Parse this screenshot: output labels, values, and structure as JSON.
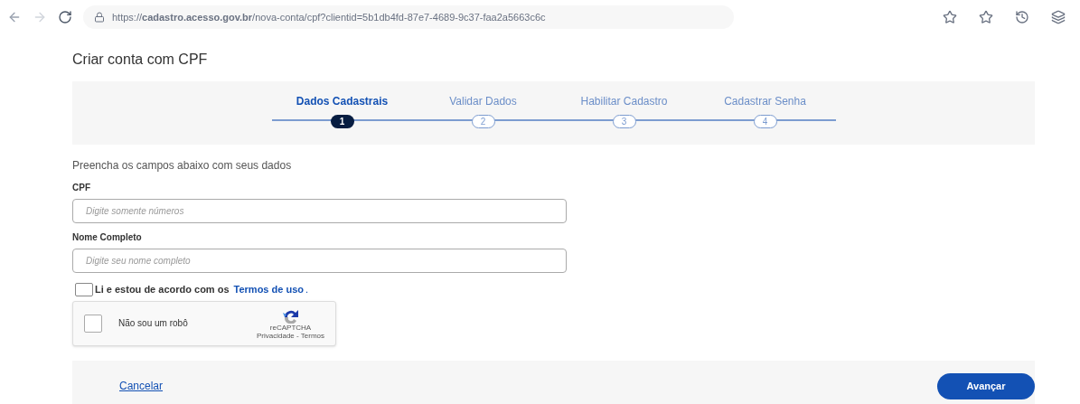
{
  "browser": {
    "url": "https://**cadastro.acesso.gov.br**/nova-conta/cpf?clientid=5b1db4fd-87e7-4689-9c37-faa2a5663c6c"
  },
  "page_title": "Criar conta com CPF",
  "steps": [
    {
      "label": "Dados Cadastrais",
      "number": "1",
      "selected": true
    },
    {
      "label": "Validar Dados",
      "number": "2",
      "selected": false
    },
    {
      "label": "Habilitar Cadastro",
      "number": "3",
      "selected": false
    },
    {
      "label": "Cadastrar Senha",
      "number": "4",
      "selected": false
    }
  ],
  "intro": "Preencha os campos abaixo com seus dados",
  "fields": [
    {
      "label": "CPF",
      "placeholder": "Digite somente números"
    },
    {
      "label": "Nome Completo",
      "placeholder": "Digite seu nome completo"
    }
  ],
  "terms": {
    "text": "Li e estou de acordo com os",
    "link": "Termos de uso",
    "suffix": ".",
    "checked": false
  },
  "captcha": {
    "label": "Não sou um robô",
    "brand": "reCAPTCHA",
    "links": "Privacidade - Termos",
    "checked": false
  },
  "footer": {
    "cancel": "Cancelar",
    "next": "Avançar"
  }
}
